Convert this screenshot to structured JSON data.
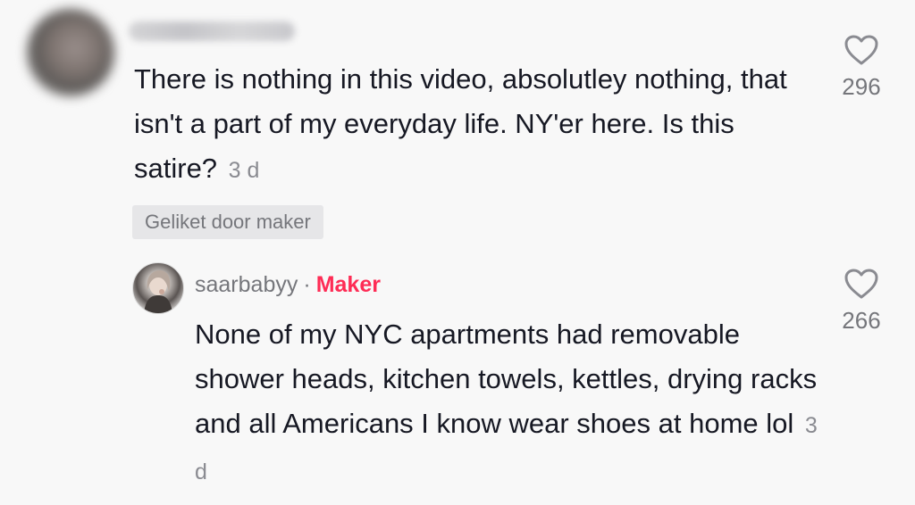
{
  "comment": {
    "text": "There is nothing in this video, absolutley nothing, that isn't a part of my everyday life. NY'er here. Is this satire?",
    "time": "3 d",
    "liked_badge": "Geliket door maker",
    "likes": "296",
    "like_icon": "heart-outline-icon"
  },
  "reply": {
    "username": "saarbabyy",
    "separator": "·",
    "creator_badge": "Maker",
    "text": "None of my NYC apartments had removable shower heads, kitchen towels, kettles, drying racks and all Americans I know wear shoes at home lol",
    "time": "3 d",
    "likes": "266",
    "like_icon": "heart-outline-icon"
  },
  "colors": {
    "background": "#f8f8f8",
    "text_primary": "#161823",
    "text_secondary": "#75767b",
    "creator_accent": "#fe2c55",
    "badge_background": "#e6e6e8"
  }
}
